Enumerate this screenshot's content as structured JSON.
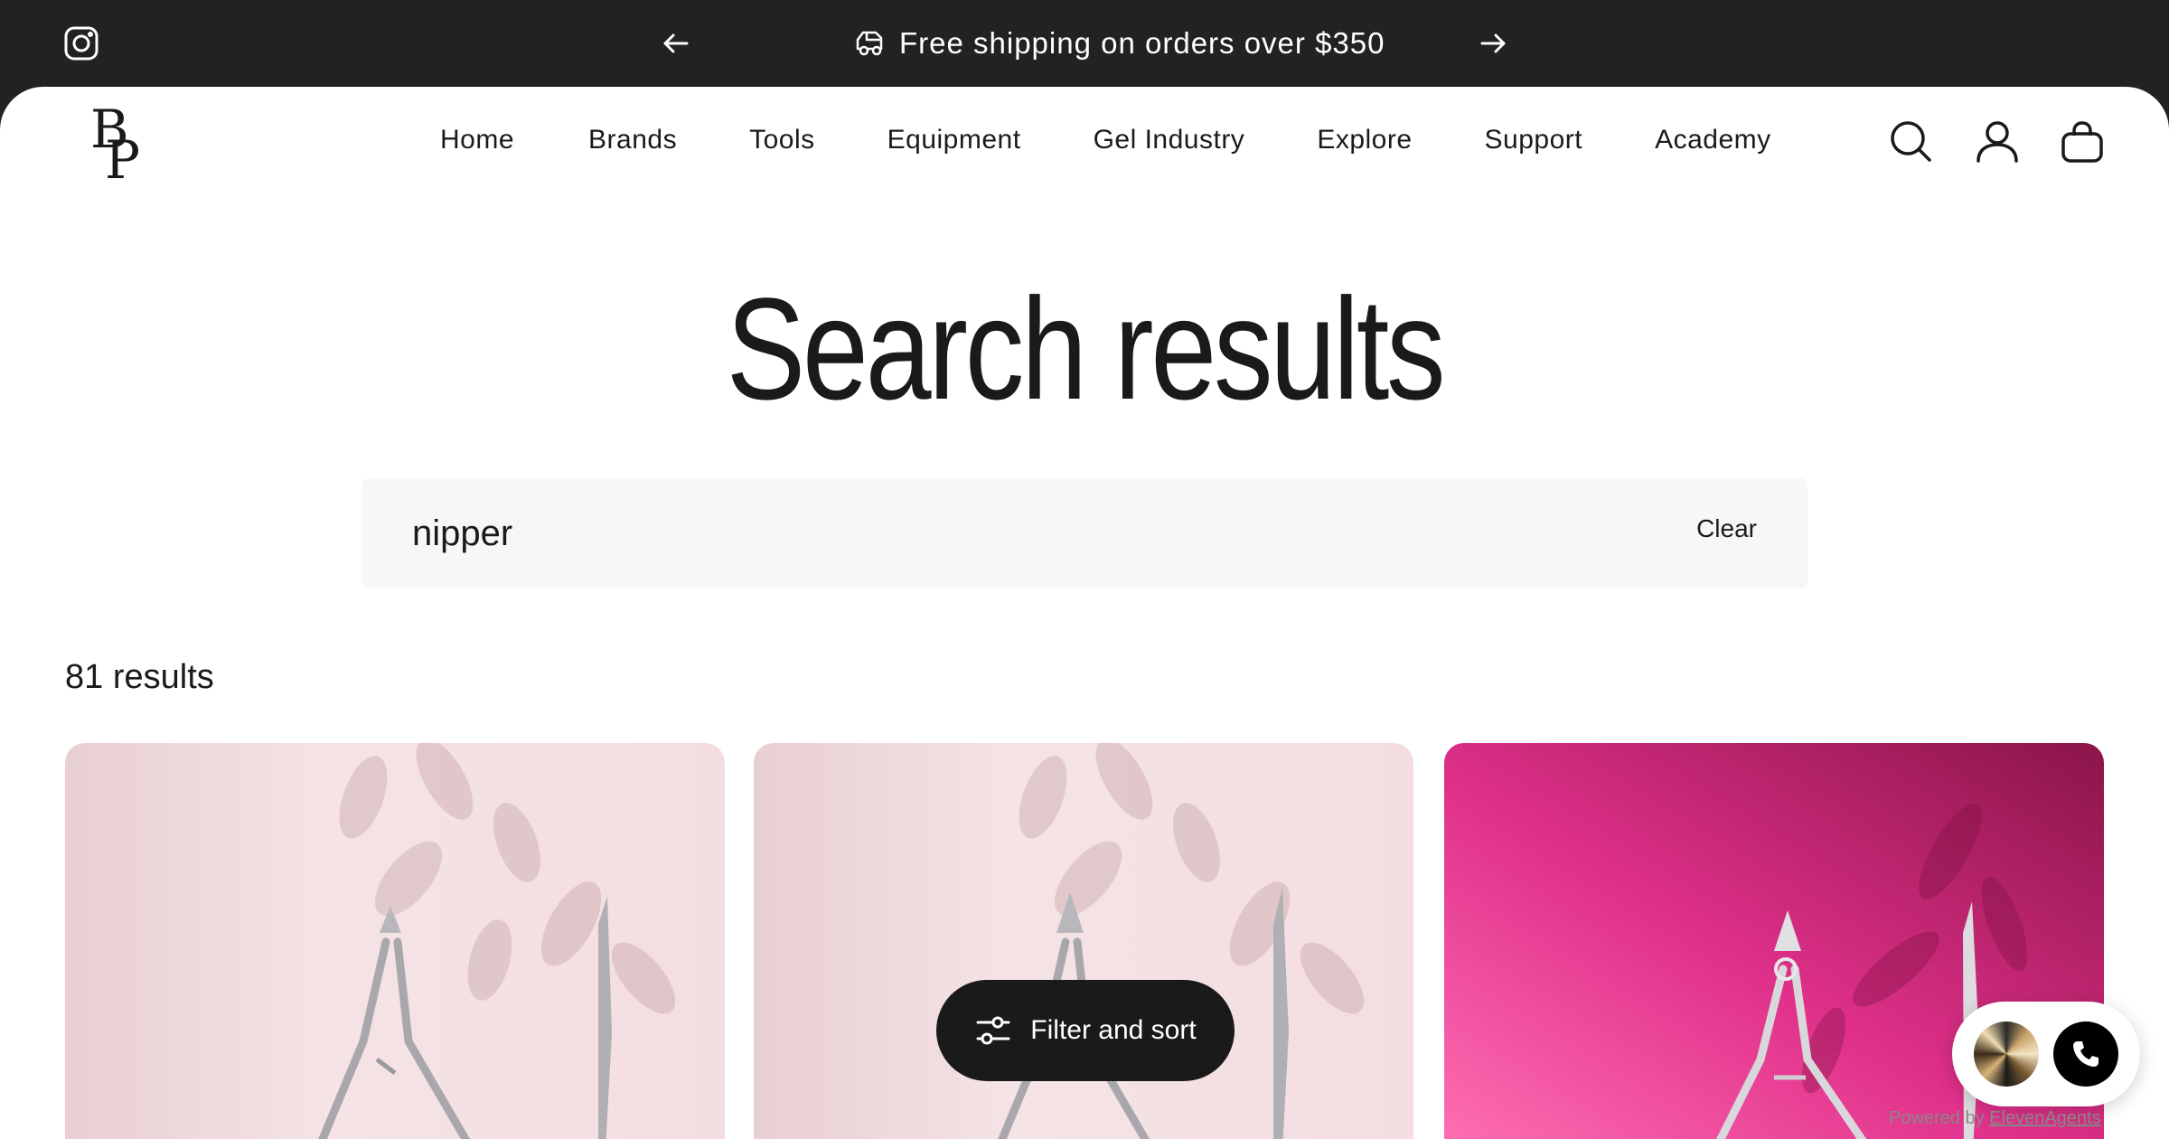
{
  "announcement": {
    "message": "Free shipping on orders over $350",
    "icons": {
      "social": "instagram-icon",
      "prev": "arrow-left-icon",
      "next": "arrow-right-icon",
      "truck": "truck-icon"
    }
  },
  "header": {
    "logo": {
      "top": "B",
      "bottom": "P"
    },
    "nav": [
      "Home",
      "Brands",
      "Tools",
      "Equipment",
      "Gel Industry",
      "Explore",
      "Support",
      "Academy"
    ],
    "icons": [
      "search-icon",
      "account-icon",
      "cart-icon"
    ]
  },
  "page": {
    "title": "Search results",
    "search": {
      "value": "nipper",
      "clear_label": "Clear"
    },
    "results_count": "81 results"
  },
  "filter": {
    "label": "Filter and sort",
    "icon": "sliders-icon"
  },
  "widget": {
    "call_icon": "phone-icon",
    "powered_prefix": "Powered by ",
    "powered_brand": "ElevenAgents"
  },
  "colors": {
    "topbar": "#222222",
    "accent_dark": "#1a1a1a",
    "card_pink_light": "#f3dde0",
    "card_pink_hot": "#e0308a"
  }
}
